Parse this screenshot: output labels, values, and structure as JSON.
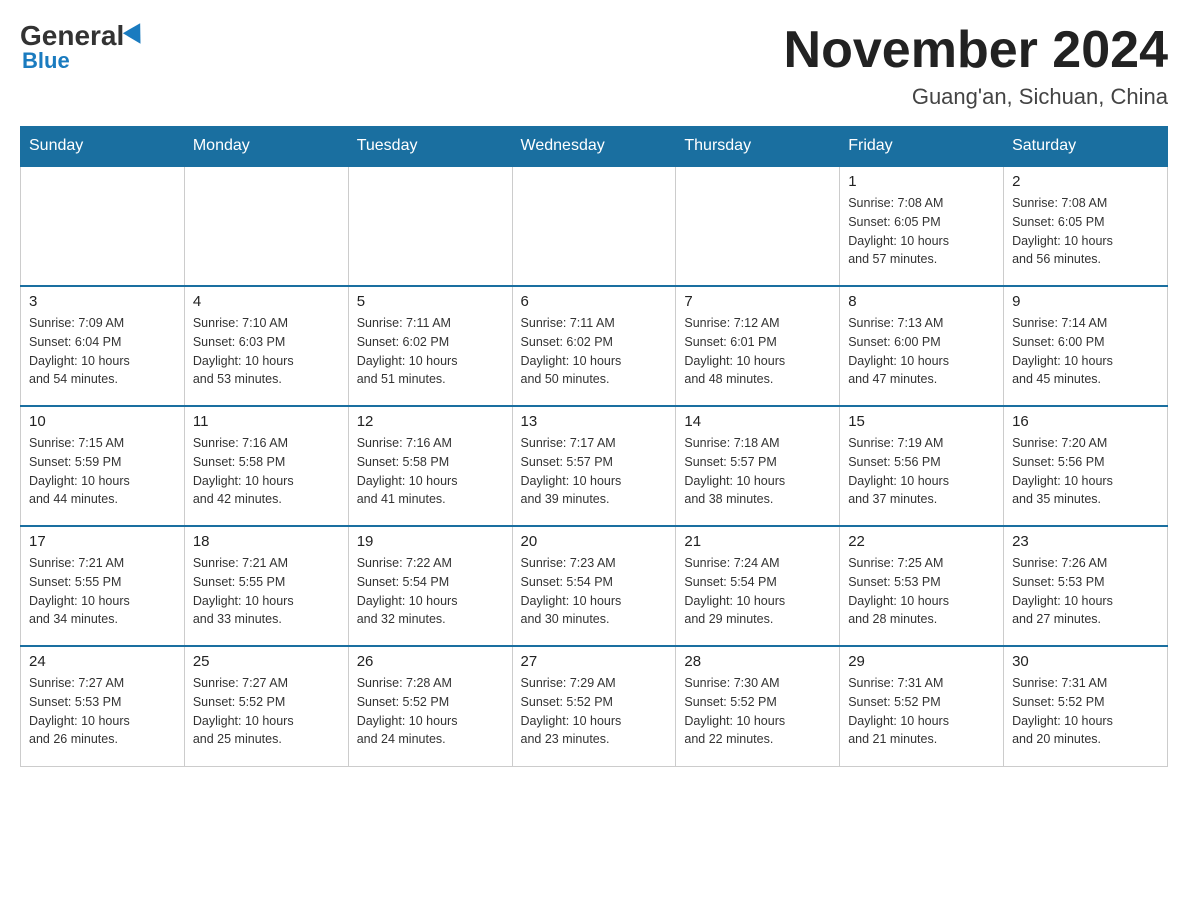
{
  "header": {
    "logo_general": "General",
    "logo_blue": "Blue",
    "month_title": "November 2024",
    "location": "Guang'an, Sichuan, China"
  },
  "weekdays": [
    "Sunday",
    "Monday",
    "Tuesday",
    "Wednesday",
    "Thursday",
    "Friday",
    "Saturday"
  ],
  "weeks": [
    {
      "days": [
        {
          "num": "",
          "info": ""
        },
        {
          "num": "",
          "info": ""
        },
        {
          "num": "",
          "info": ""
        },
        {
          "num": "",
          "info": ""
        },
        {
          "num": "",
          "info": ""
        },
        {
          "num": "1",
          "info": "Sunrise: 7:08 AM\nSunset: 6:05 PM\nDaylight: 10 hours\nand 57 minutes."
        },
        {
          "num": "2",
          "info": "Sunrise: 7:08 AM\nSunset: 6:05 PM\nDaylight: 10 hours\nand 56 minutes."
        }
      ]
    },
    {
      "days": [
        {
          "num": "3",
          "info": "Sunrise: 7:09 AM\nSunset: 6:04 PM\nDaylight: 10 hours\nand 54 minutes."
        },
        {
          "num": "4",
          "info": "Sunrise: 7:10 AM\nSunset: 6:03 PM\nDaylight: 10 hours\nand 53 minutes."
        },
        {
          "num": "5",
          "info": "Sunrise: 7:11 AM\nSunset: 6:02 PM\nDaylight: 10 hours\nand 51 minutes."
        },
        {
          "num": "6",
          "info": "Sunrise: 7:11 AM\nSunset: 6:02 PM\nDaylight: 10 hours\nand 50 minutes."
        },
        {
          "num": "7",
          "info": "Sunrise: 7:12 AM\nSunset: 6:01 PM\nDaylight: 10 hours\nand 48 minutes."
        },
        {
          "num": "8",
          "info": "Sunrise: 7:13 AM\nSunset: 6:00 PM\nDaylight: 10 hours\nand 47 minutes."
        },
        {
          "num": "9",
          "info": "Sunrise: 7:14 AM\nSunset: 6:00 PM\nDaylight: 10 hours\nand 45 minutes."
        }
      ]
    },
    {
      "days": [
        {
          "num": "10",
          "info": "Sunrise: 7:15 AM\nSunset: 5:59 PM\nDaylight: 10 hours\nand 44 minutes."
        },
        {
          "num": "11",
          "info": "Sunrise: 7:16 AM\nSunset: 5:58 PM\nDaylight: 10 hours\nand 42 minutes."
        },
        {
          "num": "12",
          "info": "Sunrise: 7:16 AM\nSunset: 5:58 PM\nDaylight: 10 hours\nand 41 minutes."
        },
        {
          "num": "13",
          "info": "Sunrise: 7:17 AM\nSunset: 5:57 PM\nDaylight: 10 hours\nand 39 minutes."
        },
        {
          "num": "14",
          "info": "Sunrise: 7:18 AM\nSunset: 5:57 PM\nDaylight: 10 hours\nand 38 minutes."
        },
        {
          "num": "15",
          "info": "Sunrise: 7:19 AM\nSunset: 5:56 PM\nDaylight: 10 hours\nand 37 minutes."
        },
        {
          "num": "16",
          "info": "Sunrise: 7:20 AM\nSunset: 5:56 PM\nDaylight: 10 hours\nand 35 minutes."
        }
      ]
    },
    {
      "days": [
        {
          "num": "17",
          "info": "Sunrise: 7:21 AM\nSunset: 5:55 PM\nDaylight: 10 hours\nand 34 minutes."
        },
        {
          "num": "18",
          "info": "Sunrise: 7:21 AM\nSunset: 5:55 PM\nDaylight: 10 hours\nand 33 minutes."
        },
        {
          "num": "19",
          "info": "Sunrise: 7:22 AM\nSunset: 5:54 PM\nDaylight: 10 hours\nand 32 minutes."
        },
        {
          "num": "20",
          "info": "Sunrise: 7:23 AM\nSunset: 5:54 PM\nDaylight: 10 hours\nand 30 minutes."
        },
        {
          "num": "21",
          "info": "Sunrise: 7:24 AM\nSunset: 5:54 PM\nDaylight: 10 hours\nand 29 minutes."
        },
        {
          "num": "22",
          "info": "Sunrise: 7:25 AM\nSunset: 5:53 PM\nDaylight: 10 hours\nand 28 minutes."
        },
        {
          "num": "23",
          "info": "Sunrise: 7:26 AM\nSunset: 5:53 PM\nDaylight: 10 hours\nand 27 minutes."
        }
      ]
    },
    {
      "days": [
        {
          "num": "24",
          "info": "Sunrise: 7:27 AM\nSunset: 5:53 PM\nDaylight: 10 hours\nand 26 minutes."
        },
        {
          "num": "25",
          "info": "Sunrise: 7:27 AM\nSunset: 5:52 PM\nDaylight: 10 hours\nand 25 minutes."
        },
        {
          "num": "26",
          "info": "Sunrise: 7:28 AM\nSunset: 5:52 PM\nDaylight: 10 hours\nand 24 minutes."
        },
        {
          "num": "27",
          "info": "Sunrise: 7:29 AM\nSunset: 5:52 PM\nDaylight: 10 hours\nand 23 minutes."
        },
        {
          "num": "28",
          "info": "Sunrise: 7:30 AM\nSunset: 5:52 PM\nDaylight: 10 hours\nand 22 minutes."
        },
        {
          "num": "29",
          "info": "Sunrise: 7:31 AM\nSunset: 5:52 PM\nDaylight: 10 hours\nand 21 minutes."
        },
        {
          "num": "30",
          "info": "Sunrise: 7:31 AM\nSunset: 5:52 PM\nDaylight: 10 hours\nand 20 minutes."
        }
      ]
    }
  ]
}
